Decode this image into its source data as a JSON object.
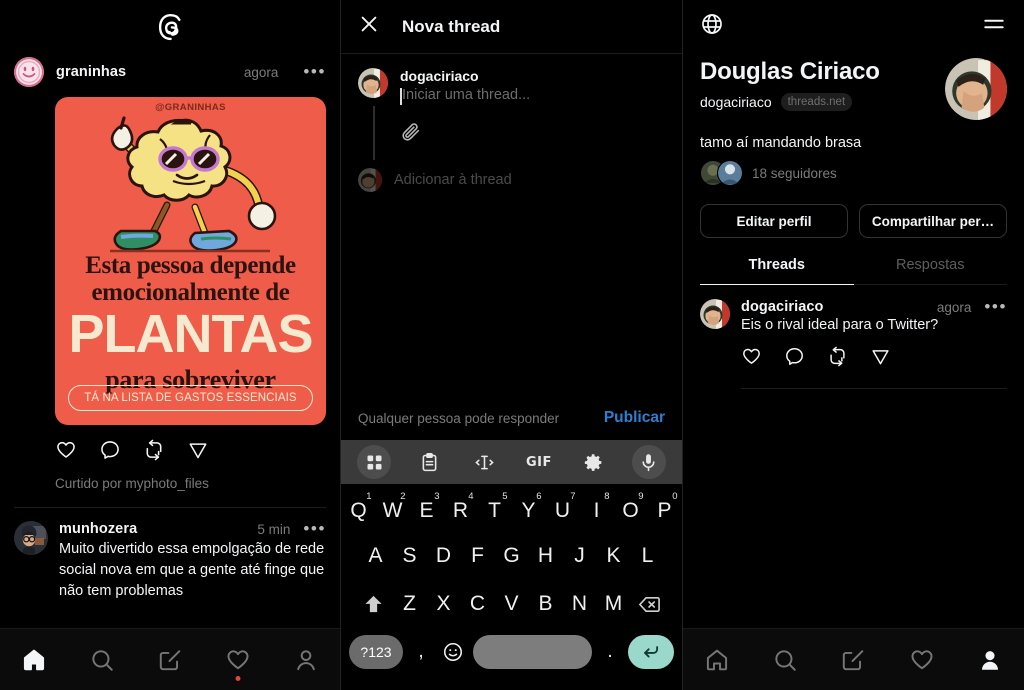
{
  "app": {
    "name": "Threads",
    "accent": "#2f7fd1",
    "enter_key_color": "#9ad8cb"
  },
  "panel_feed": {
    "logo_icon": "threads-logo",
    "post": {
      "avatar_icon": "avatar-graninhas",
      "username": "graninhas",
      "time": "agora",
      "more_icon": "more-options-icon",
      "image": {
        "handle": "@GRANINHAS",
        "line1": "Esta pessoa depende",
        "line2": "emocionalmente de",
        "headline": "PLANTAS",
        "line3": "para sobreviver",
        "pill": "TÁ NA LISTA DE GASTOS ESSENCIAIS",
        "bg_color": "#ef5c49",
        "cream_color": "#f5ead0",
        "dark_color": "#2b1410",
        "art_icon": "cartoon-brain-mascot"
      },
      "actions": [
        "like-icon",
        "comment-icon",
        "repost-icon",
        "share-icon"
      ],
      "liked_by": "Curtido por myphoto_files"
    },
    "post2": {
      "avatar_icon": "avatar-munhozera",
      "username": "munhozera",
      "time": "5 min",
      "more_icon": "more-options-icon",
      "text": "Muito divertido essa empolgação de rede social nova em que a gente até finge que não tem problemas"
    },
    "nav": [
      {
        "icon": "home-icon",
        "active": true,
        "badge": false
      },
      {
        "icon": "search-icon",
        "active": false,
        "badge": false
      },
      {
        "icon": "compose-icon",
        "active": false,
        "badge": false
      },
      {
        "icon": "heart-icon",
        "active": false,
        "badge": true
      },
      {
        "icon": "profile-icon",
        "active": false,
        "badge": false
      }
    ]
  },
  "panel_composer": {
    "header": {
      "close_icon": "close-icon",
      "title": "Nova thread"
    },
    "compose": {
      "avatar_icon": "avatar-dogaciriaco",
      "username": "dogaciriaco",
      "placeholder": "Iniciar uma thread...",
      "attach_icon": "paperclip-icon"
    },
    "add_to_thread": {
      "avatar_icon": "avatar-dogaciriaco-dim",
      "label": "Adicionar à thread"
    },
    "publish_bar": {
      "reply_note": "Qualquer pessoa pode responder",
      "publish_label": "Publicar"
    },
    "kb_toolbar": [
      {
        "icon": "grid-apps-icon",
        "selected": true,
        "label": ""
      },
      {
        "icon": "clipboard-icon",
        "selected": false,
        "label": ""
      },
      {
        "icon": "text-cursor-icon",
        "selected": false,
        "label": ""
      },
      {
        "icon": "gif-icon",
        "selected": false,
        "label": "GIF"
      },
      {
        "icon": "gear-icon",
        "selected": false,
        "label": ""
      },
      {
        "icon": "microphone-icon",
        "selected": true,
        "label": ""
      }
    ],
    "keyboard": {
      "row1": [
        {
          "key": "Q",
          "sup": "1"
        },
        {
          "key": "W",
          "sup": "2"
        },
        {
          "key": "E",
          "sup": "3"
        },
        {
          "key": "R",
          "sup": "4"
        },
        {
          "key": "T",
          "sup": "5"
        },
        {
          "key": "Y",
          "sup": "6"
        },
        {
          "key": "U",
          "sup": "7"
        },
        {
          "key": "I",
          "sup": "8"
        },
        {
          "key": "O",
          "sup": "9"
        },
        {
          "key": "P",
          "sup": "0"
        }
      ],
      "row2": [
        "A",
        "S",
        "D",
        "F",
        "G",
        "H",
        "J",
        "K",
        "L"
      ],
      "row3": [
        "Z",
        "X",
        "C",
        "V",
        "B",
        "N",
        "M"
      ],
      "shift_icon": "shift-icon",
      "backspace_icon": "backspace-icon",
      "numeric_key": "?123",
      "comma_key": ",",
      "emoji_icon": "emoji-icon",
      "space_key": "",
      "period_key": ".",
      "enter_icon": "enter-icon"
    }
  },
  "panel_profile": {
    "header": {
      "globe_icon": "globe-icon",
      "menu_icon": "hamburger-menu-icon"
    },
    "name": "Douglas Ciriaco",
    "handle": "dogaciriaco",
    "badge": "threads.net",
    "bio": "tamo aí mandando brasa",
    "followers": "18 seguidores",
    "avatar_icon": "avatar-dogaciriaco",
    "buttons": [
      {
        "label": "Editar perfil",
        "name": "edit-profile-button"
      },
      {
        "label": "Compartilhar per…",
        "name": "share-profile-button"
      }
    ],
    "tabs": [
      {
        "label": "Threads",
        "active": true
      },
      {
        "label": "Respostas",
        "active": false
      }
    ],
    "post": {
      "avatar_icon": "avatar-dogaciriaco",
      "username": "dogaciriaco",
      "time": "agora",
      "more_icon": "more-options-icon",
      "text": "Eis o rival ideal para o Twitter?",
      "actions": [
        "like-icon",
        "comment-icon",
        "repost-icon",
        "share-icon"
      ]
    },
    "nav": [
      {
        "icon": "home-icon",
        "active": false
      },
      {
        "icon": "search-icon",
        "active": false
      },
      {
        "icon": "compose-icon",
        "active": false
      },
      {
        "icon": "heart-icon",
        "active": false
      },
      {
        "icon": "profile-icon",
        "active": true
      }
    ]
  }
}
